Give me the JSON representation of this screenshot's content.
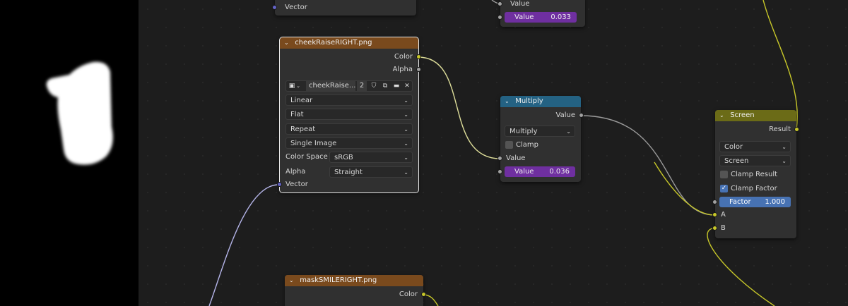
{
  "colors": {
    "background": "#1d1d1d",
    "node_body": "#303030",
    "image_header": "#7a4a1d",
    "math_header": "#246283",
    "mix_header": "#6b6b17",
    "value_field": "#6f2fa0",
    "factor_field": "#4772b3",
    "socket_color": "#c7c729",
    "socket_float": "#a1a1a1",
    "socket_vector": "#6363c7"
  },
  "top_fragment": {
    "vector_label": "Vector"
  },
  "top_math_fragment": {
    "input_label": "Value",
    "field_label": "Value",
    "field_value": "0.033"
  },
  "cheek_node": {
    "title": "cheekRaiseRIGHT.png",
    "output_color": "Color",
    "output_alpha": "Alpha",
    "image_name": "cheekRaise...",
    "user_count": "2",
    "interpolation": "Linear",
    "projection": "Flat",
    "extension": "Repeat",
    "source": "Single Image",
    "color_space_label": "Color Space",
    "color_space_value": "sRGB",
    "alpha_label": "Alpha",
    "alpha_value": "Straight",
    "input_vector": "Vector"
  },
  "multiply_node": {
    "title": "Multiply",
    "output_value": "Value",
    "operation": "Multiply",
    "clamp_label": "Clamp",
    "input_value": "Value",
    "field_label": "Value",
    "field_value": "0.036"
  },
  "screen_node": {
    "title": "Screen",
    "output_result": "Result",
    "data_type": "Color",
    "blend_mode": "Screen",
    "clamp_result_label": "Clamp Result",
    "clamp_factor_label": "Clamp Factor",
    "factor_label": "Factor",
    "factor_value": "1.000",
    "input_a": "A",
    "input_b": "B"
  },
  "mask_node": {
    "title": "maskSMILERIGHT.png",
    "output_color": "Color"
  }
}
